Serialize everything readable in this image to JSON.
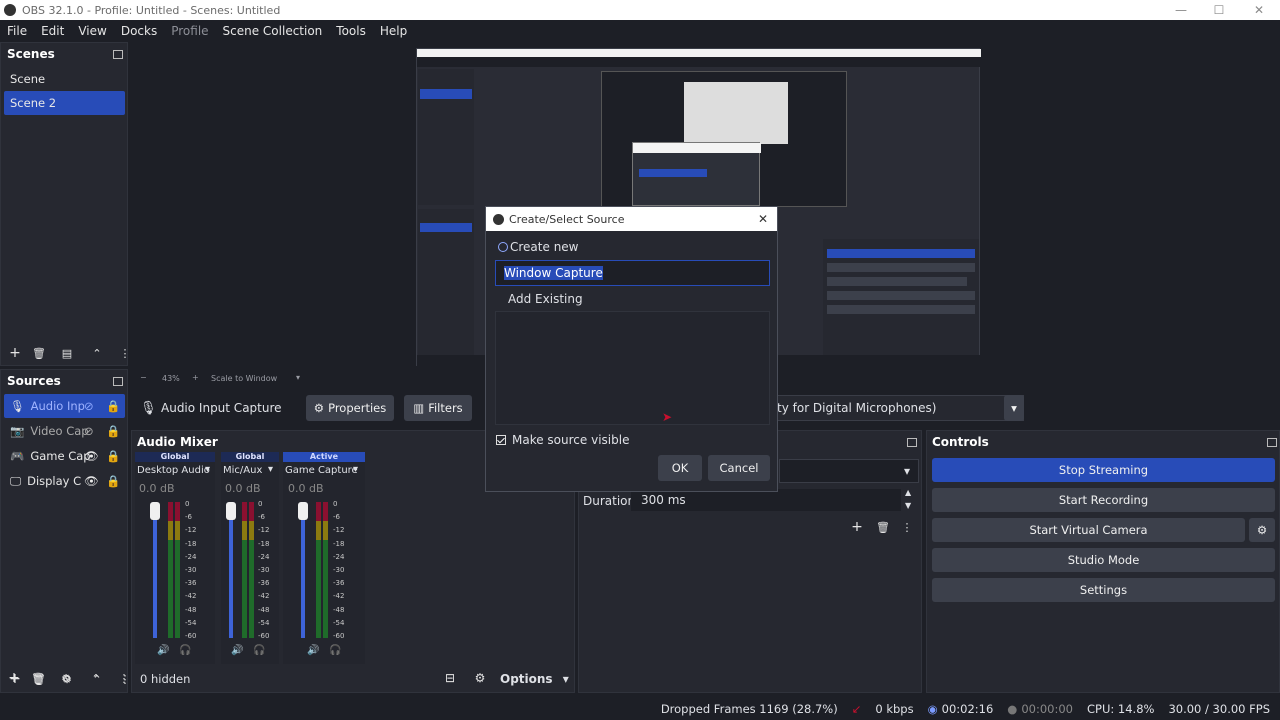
{
  "window": {
    "title": "OBS 32.1.0 - Profile: Untitled - Scenes: Untitled"
  },
  "menu": [
    "File",
    "Edit",
    "View",
    "Docks",
    "Profile",
    "Scene Collection",
    "Tools",
    "Help"
  ],
  "scenes": {
    "title": "Scenes",
    "items": [
      "Scene",
      "Scene 2"
    ]
  },
  "sources": {
    "title": "Sources",
    "items": [
      "Audio Inp",
      "Video Cap",
      "Game Cap",
      "Display C"
    ]
  },
  "preview": {
    "zoom": "43%",
    "scale_mode": "Scale to Window"
  },
  "source_toolbar": {
    "selected": "Audio Input Capture",
    "properties": "Properties",
    "filters": "Filters",
    "device": "ty for Digital Microphones)"
  },
  "mixer": {
    "title": "Audio Mixer",
    "channels": [
      {
        "tag": "Global",
        "name": "Desktop Audio",
        "db": "0.0 dB"
      },
      {
        "tag": "Global",
        "name": "Mic/Aux",
        "db": "0.0 dB"
      },
      {
        "tag": "Active",
        "name": "Game Capture",
        "db": "0.0 dB"
      }
    ],
    "ticks": [
      "0",
      "-6",
      "-12",
      "-18",
      "-24",
      "-30",
      "-36",
      "-42",
      "-48",
      "-54",
      "-60"
    ],
    "hidden_label": "0 hidden",
    "options_label": "Options"
  },
  "transitions": {
    "duration_label": "Duration",
    "duration_value": "300 ms"
  },
  "controls": {
    "title": "Controls",
    "stop_streaming": "Stop Streaming",
    "start_recording": "Start Recording",
    "start_virtual_camera": "Start Virtual Camera",
    "studio_mode": "Studio Mode",
    "settings": "Settings"
  },
  "dialog": {
    "title": "Create/Select Source",
    "create_new": "Create new",
    "name_value": "Window Capture",
    "add_existing": "Add Existing",
    "make_visible": "Make source visible",
    "ok": "OK",
    "cancel": "Cancel"
  },
  "status": {
    "dropped_frames": "Dropped Frames 1169 (28.7%)",
    "kbps": "0 kbps",
    "stream_time": "00:02:16",
    "rec_time": "00:00:00",
    "cpu": "CPU: 14.8%",
    "fps": "30.00 / 30.00 FPS"
  },
  "colors": {
    "accent": "#284cb8",
    "bg": "#1d1f26",
    "panel": "#262830"
  }
}
